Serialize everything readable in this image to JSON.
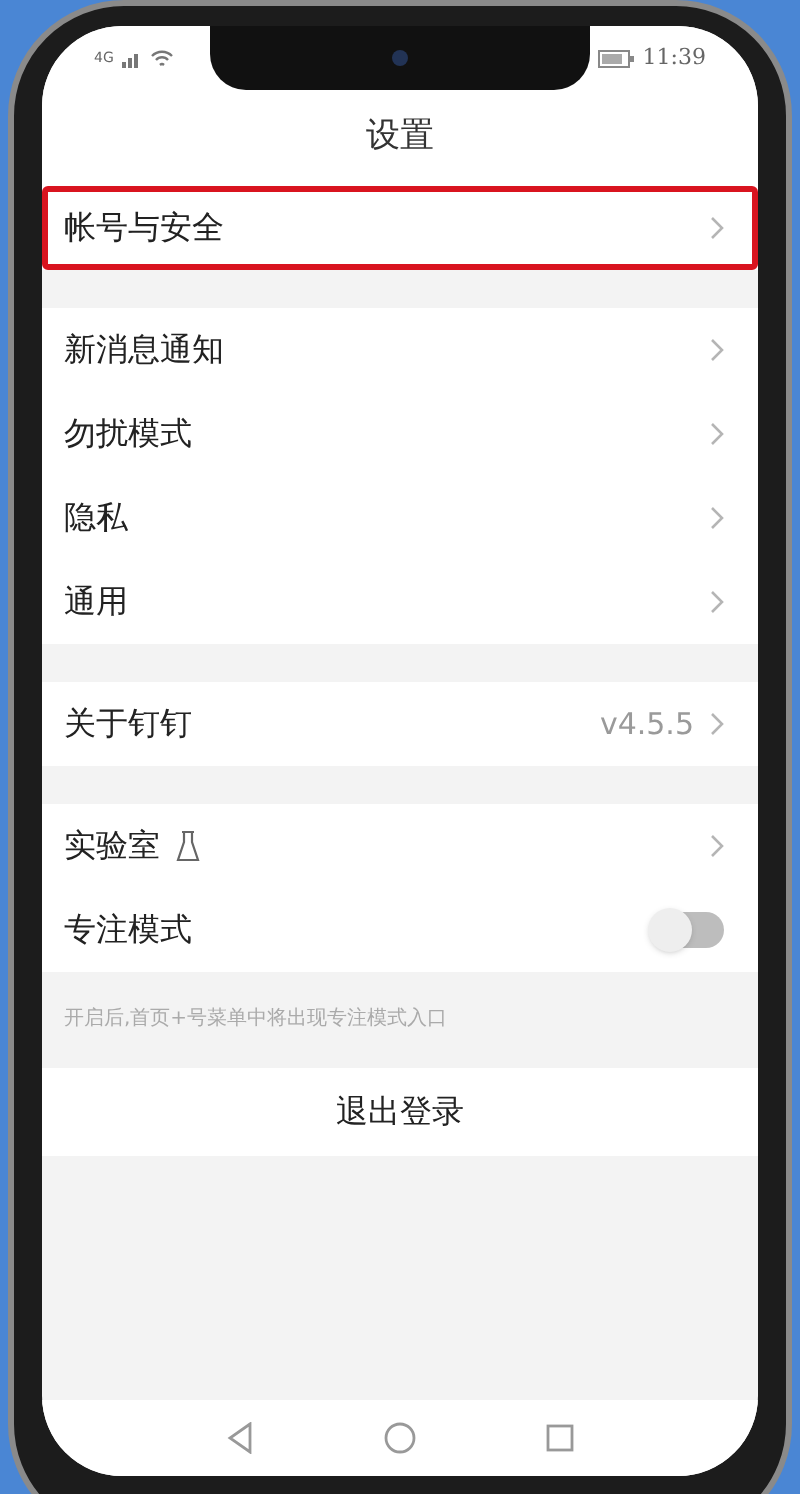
{
  "status_bar": {
    "network": "4G",
    "time": "11:39"
  },
  "title": "设置",
  "groups": [
    {
      "rows": [
        {
          "kind": "chevron",
          "label": "帐号与安全",
          "highlighted": true
        }
      ]
    },
    {
      "rows": [
        {
          "kind": "chevron",
          "label": "新消息通知",
          "highlighted": false
        },
        {
          "kind": "chevron",
          "label": "勿扰模式",
          "highlighted": false
        },
        {
          "kind": "chevron",
          "label": "隐私",
          "highlighted": false
        },
        {
          "kind": "chevron",
          "label": "通用",
          "highlighted": false
        }
      ]
    },
    {
      "rows": [
        {
          "kind": "value",
          "label": "关于钉钉",
          "value": "v4.5.5",
          "highlighted": false
        }
      ]
    },
    {
      "rows": [
        {
          "kind": "lab",
          "label": "实验室",
          "highlighted": false
        },
        {
          "kind": "toggle",
          "label": "专注模式",
          "on": false,
          "highlighted": false
        }
      ],
      "hint": "开启后,首页+号菜单中将出现专注模式入口"
    }
  ],
  "logout": "退出登录"
}
